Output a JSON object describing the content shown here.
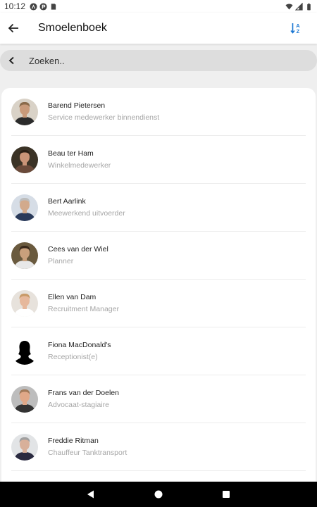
{
  "status_bar": {
    "time": "10:12",
    "left_icons": [
      "app-a-icon",
      "app-p-icon",
      "sd-card-icon"
    ],
    "right_icons": [
      "wifi-icon",
      "signal-icon",
      "battery-icon"
    ]
  },
  "app_bar": {
    "title": "Smoelenboek",
    "back_icon": "arrow-back-icon",
    "sort_icon": "sort-az-icon",
    "accent_color": "#1976d2"
  },
  "search": {
    "placeholder": "Zoeken..",
    "value": ""
  },
  "contacts": [
    {
      "name": "Barend Pietersen",
      "role": "Service medewerker binnendienst",
      "avatar_bg": "#d9d2c7",
      "avatar_skin": "#c99a7a",
      "avatar_hair": "#8a6a4a",
      "avatar_shirt": "#2b2b2b"
    },
    {
      "name": "Beau ter Ham",
      "role": "Winkelmedewerker",
      "avatar_bg": "#3b3326",
      "avatar_skin": "#c99478",
      "avatar_hair": "#2a1f16",
      "avatar_shirt": "#6a4a3a"
    },
    {
      "name": "Bert Aarlink",
      "role": "Meewerkend uitvoerder",
      "avatar_bg": "#d6dde6",
      "avatar_skin": "#d2aa8c",
      "avatar_hair": "#bdbdbd",
      "avatar_shirt": "#2a3a5a"
    },
    {
      "name": "Cees van der Wiel",
      "role": "Planner",
      "avatar_bg": "#6a5a3e",
      "avatar_skin": "#c9a07c",
      "avatar_hair": "#3a2a1c",
      "avatar_shirt": "#e8e8e8"
    },
    {
      "name": "Ellen van Dam",
      "role": "Recruitment Manager",
      "avatar_bg": "#e7e2dc",
      "avatar_skin": "#e6b89c",
      "avatar_hair": "#c89a68",
      "avatar_shirt": "#ffffff"
    },
    {
      "name": "Fiona MacDonald's",
      "role": "Receptionist(e)",
      "avatar_bg": "#ffffff",
      "avatar_skin": "#000000",
      "avatar_hair": "#000000",
      "avatar_shirt": "#000000"
    },
    {
      "name": "Frans van der Doelen",
      "role": "Advocaat-stagiaire",
      "avatar_bg": "#bdbdbd",
      "avatar_skin": "#e0a888",
      "avatar_hair": "#a27a5a",
      "avatar_shirt": "#333333"
    },
    {
      "name": "Freddie Ritman",
      "role": "Chauffeur Tanktransport",
      "avatar_bg": "#e2e4e6",
      "avatar_skin": "#d8b09a",
      "avatar_hair": "#a0a0a0",
      "avatar_shirt": "#2a2a40"
    }
  ],
  "nav_bar": {
    "buttons": [
      "nav-back-icon",
      "nav-home-icon",
      "nav-recents-icon"
    ]
  }
}
